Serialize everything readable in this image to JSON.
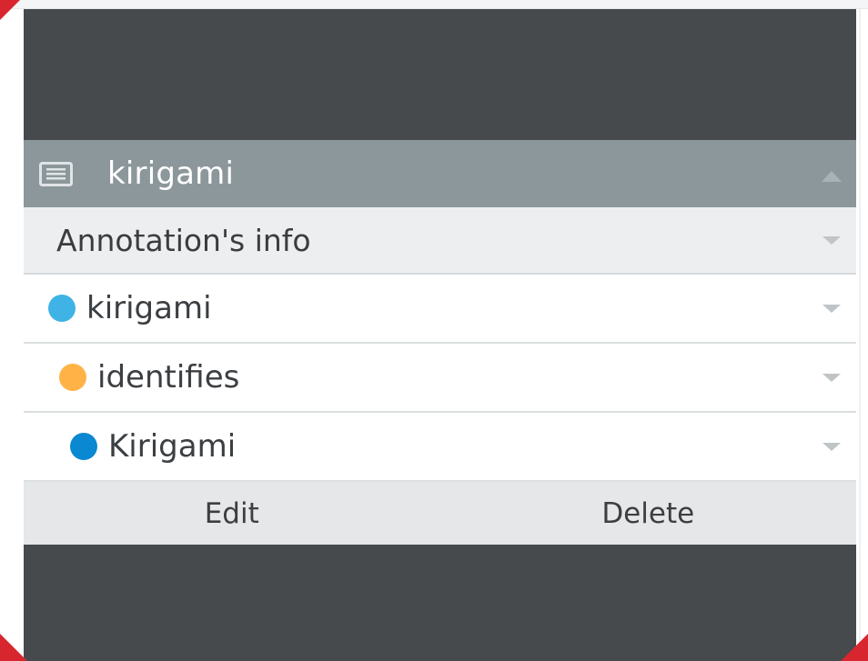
{
  "colors": {
    "panel_bg": "#464a4d",
    "header_bg": "#8c979b",
    "section_bg": "#eceeef",
    "row_bg": "#ffffff",
    "actions_bg": "#e5e7e8",
    "dot_light_blue": "#3fb3e6",
    "dot_orange": "#ffb347",
    "dot_blue": "#0a88d1",
    "frame_red": "#d8262e"
  },
  "header": {
    "icon": "document-lines-icon",
    "title": "kirigami",
    "toggle_icon": "caret-up-icon"
  },
  "section": {
    "title": "Annotation's info",
    "toggle_icon": "caret-down-icon"
  },
  "rows": [
    {
      "label": "kirigami",
      "dot_color": "#3fb3e6",
      "toggle_icon": "caret-down-icon"
    },
    {
      "label": "identifies",
      "dot_color": "#ffb347",
      "toggle_icon": "caret-down-icon"
    },
    {
      "label": "Kirigami",
      "dot_color": "#0a88d1",
      "toggle_icon": "caret-down-icon"
    }
  ],
  "actions": {
    "edit_label": "Edit",
    "delete_label": "Delete"
  }
}
